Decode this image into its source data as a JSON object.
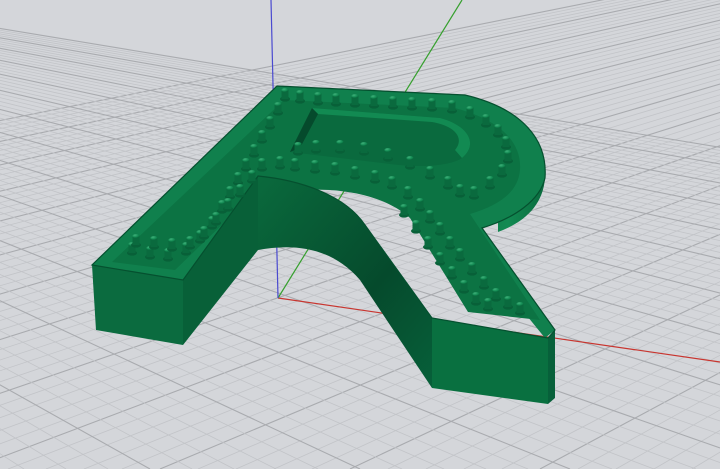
{
  "viewport": {
    "name": "Perspective",
    "background_color": "#d4d6da",
    "grid_minor_color": "#c2c4c8",
    "grid_major_color": "#a9abaf"
  },
  "axes": {
    "x_color": "#c8352f",
    "y_color": "#36a02e",
    "z_color": "#4a4ad0"
  },
  "model": {
    "shape": "letter-R-channel-letter",
    "face_color": "#0f7a4a",
    "side_color": "#07603a",
    "shade_color": "#04492b",
    "studs": "led-mount-posts"
  }
}
